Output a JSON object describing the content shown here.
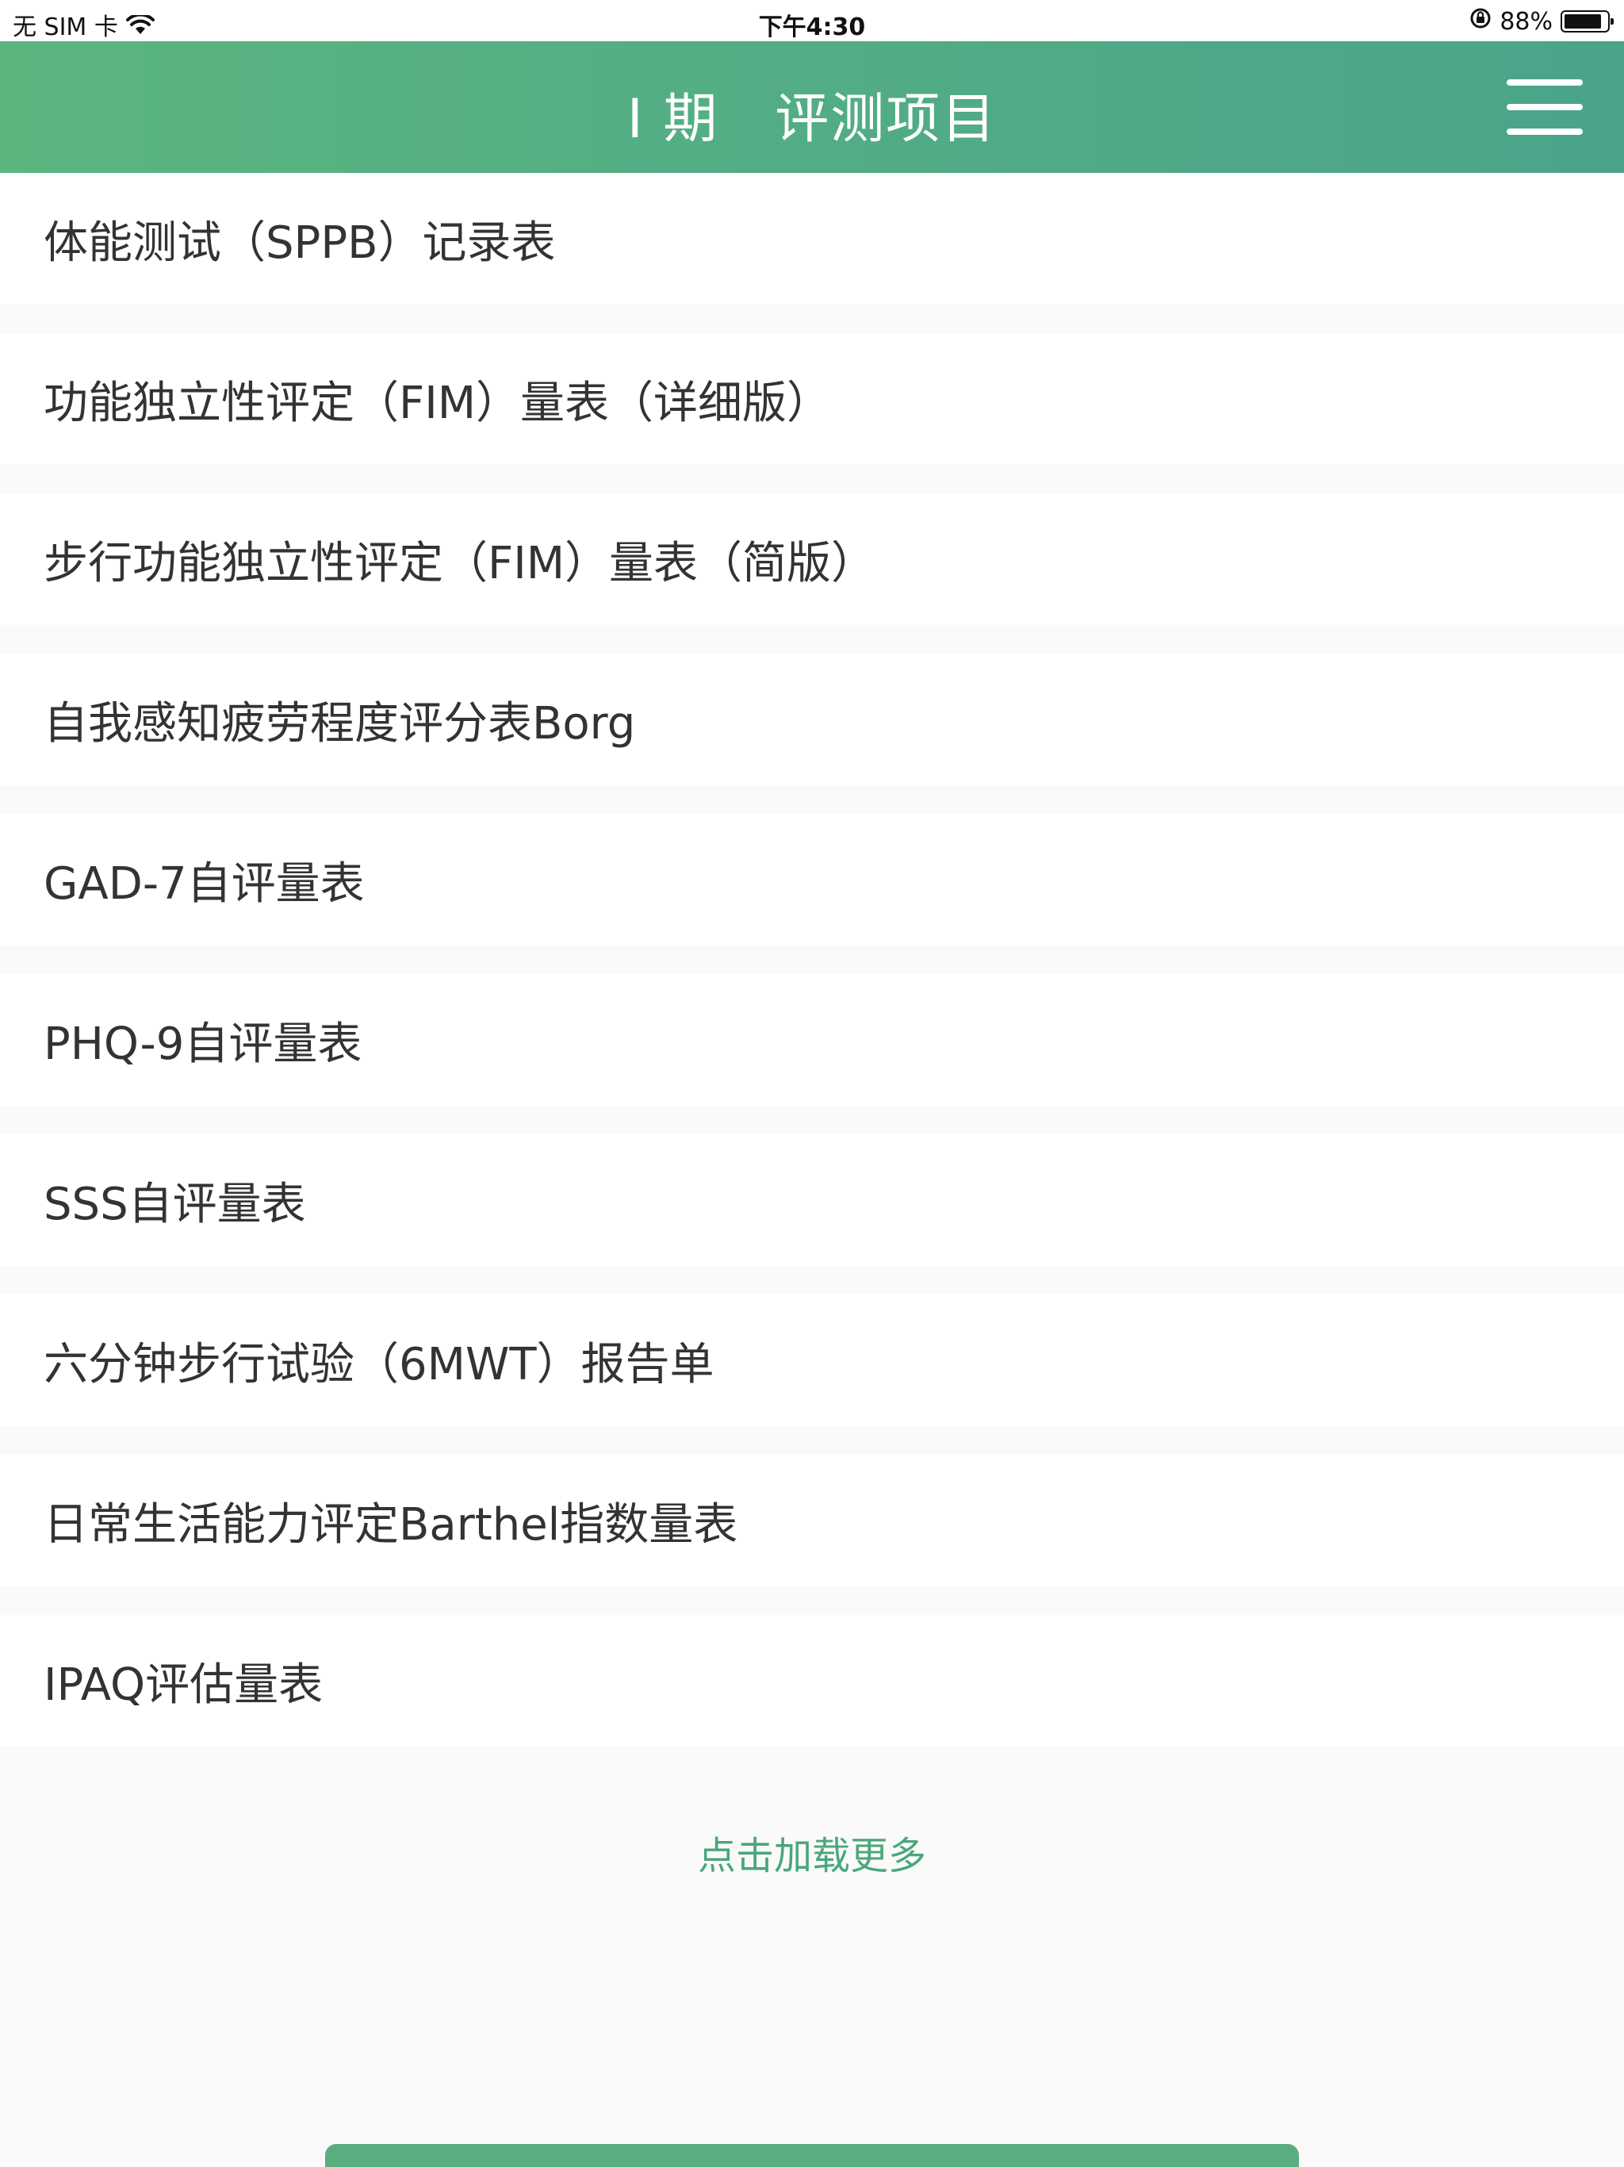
{
  "status_bar": {
    "carrier": "无 SIM 卡",
    "time": "下午4:30",
    "battery_percent": "88%",
    "battery_level": 0.88
  },
  "header": {
    "title": "I 期   评测项目"
  },
  "items": [
    {
      "label": "体能测试（SPPB）记录表"
    },
    {
      "label": "功能独立性评定（FIM）量表（详细版）"
    },
    {
      "label": "步行功能独立性评定（FIM）量表（简版）"
    },
    {
      "label": "自我感知疲劳程度评分表Borg"
    },
    {
      "label": "GAD-7自评量表"
    },
    {
      "label": "PHQ-9自评量表"
    },
    {
      "label": "SSS自评量表"
    },
    {
      "label": "六分钟步行试验（6MWT）报告单"
    },
    {
      "label": "日常生活能力评定Barthel指数量表"
    },
    {
      "label": "IPAQ评估量表"
    }
  ],
  "load_more": "点击加载更多",
  "colors": {
    "header_start": "#5ab57f",
    "header_end": "#4aa48a",
    "accent": "#4aa77b"
  }
}
